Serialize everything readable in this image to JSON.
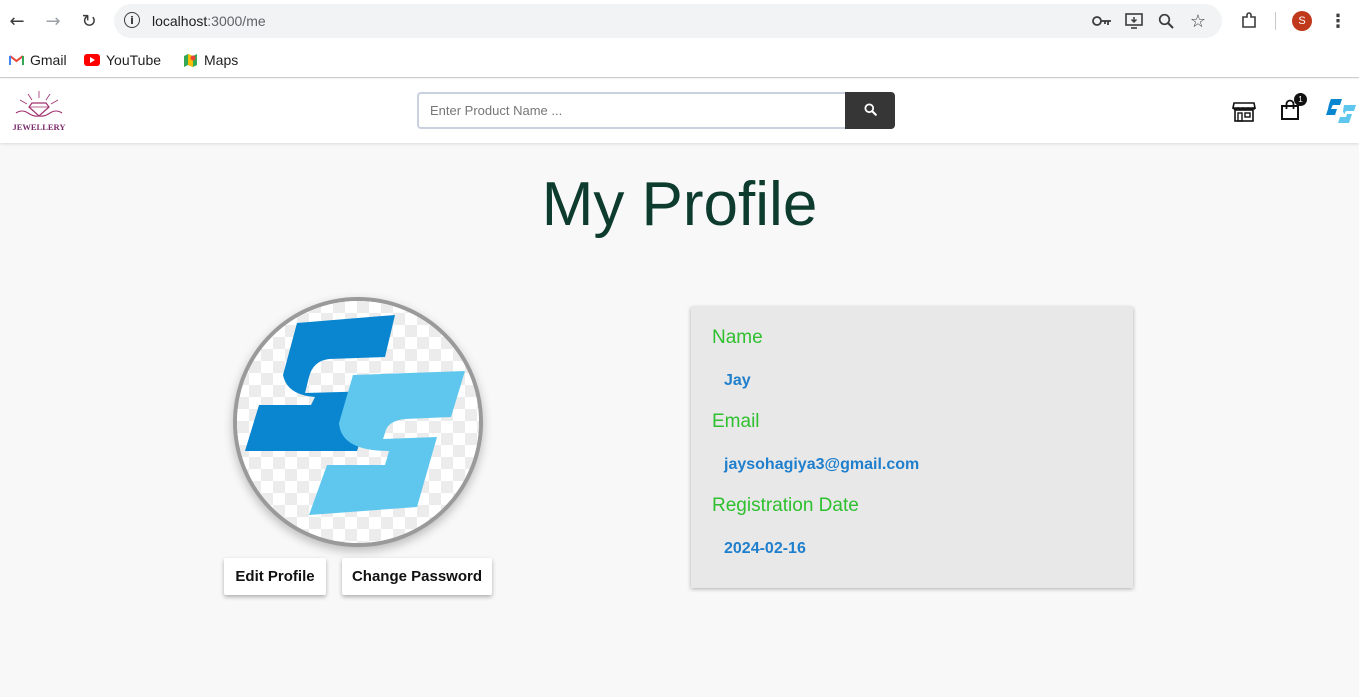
{
  "browser": {
    "url_host": "localhost",
    "url_path": ":3000/me",
    "profile_initial": "S",
    "bookmarks": [
      {
        "label": "Gmail",
        "icon": "gmail-icon"
      },
      {
        "label": "YouTube",
        "icon": "youtube-icon"
      },
      {
        "label": "Maps",
        "icon": "maps-icon"
      }
    ]
  },
  "header": {
    "logo_text": "JEWELLERY",
    "search_placeholder": "Enter Product Name ...",
    "cart_count": "1"
  },
  "main": {
    "title": "My Profile",
    "buttons": {
      "edit": "Edit Profile",
      "change_password": "Change Password"
    },
    "details": [
      {
        "label": "Name",
        "value": "Jay"
      },
      {
        "label": "Email",
        "value": "jaysohagiya3@gmail.com"
      },
      {
        "label": "Registration Date",
        "value": "2024-02-16"
      }
    ]
  },
  "colors": {
    "title": "#0d3b2e",
    "label": "#2ec02e",
    "value": "#1f7fcc",
    "logo_dark_blue": "#0a86d0",
    "logo_light_blue": "#5fc7ee"
  }
}
